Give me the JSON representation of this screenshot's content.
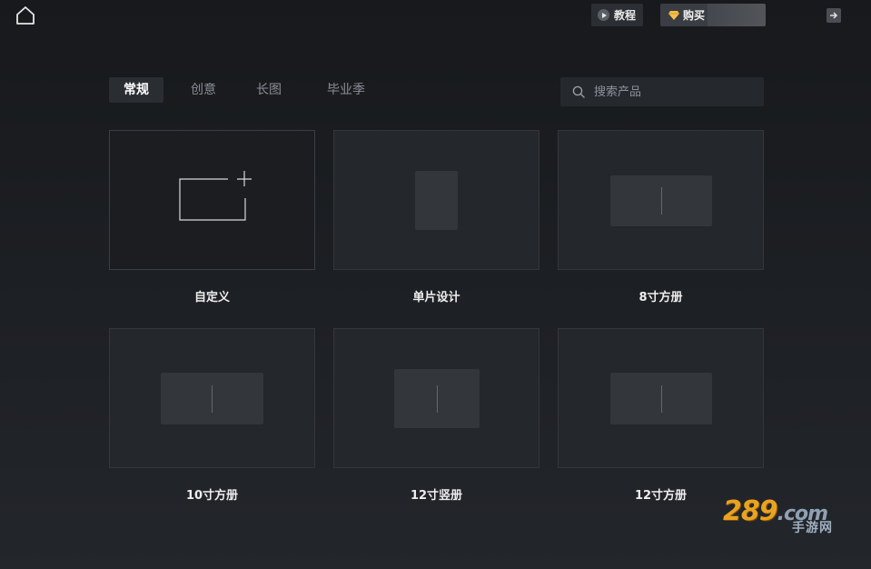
{
  "header": {
    "tutorial_label": "教程",
    "vip_label": "购买"
  },
  "tabs": [
    {
      "label": "常规",
      "active": true
    },
    {
      "label": "创意",
      "active": false
    },
    {
      "label": "长图",
      "active": false
    },
    {
      "label": "毕业季",
      "active": false
    }
  ],
  "search": {
    "placeholder": "搜索产品",
    "value": ""
  },
  "products": [
    {
      "label": "自定义",
      "thumb": "custom-plus-icon"
    },
    {
      "label": "单片设计",
      "thumb": "single-page"
    },
    {
      "label": "8寸方册",
      "thumb": "square-album"
    },
    {
      "label": "10寸方册",
      "thumb": "square-album"
    },
    {
      "label": "12寸竖册",
      "thumb": "portrait-album"
    },
    {
      "label": "12寸方册",
      "thumb": "square-album"
    }
  ],
  "watermark": {
    "brand": "289",
    "suffix": ".com",
    "site": "手游网"
  },
  "colors": {
    "background": "#1d2024",
    "card": "#24272b",
    "tab_active": "#2a2d32",
    "watermark_orange": "#e8a320"
  }
}
